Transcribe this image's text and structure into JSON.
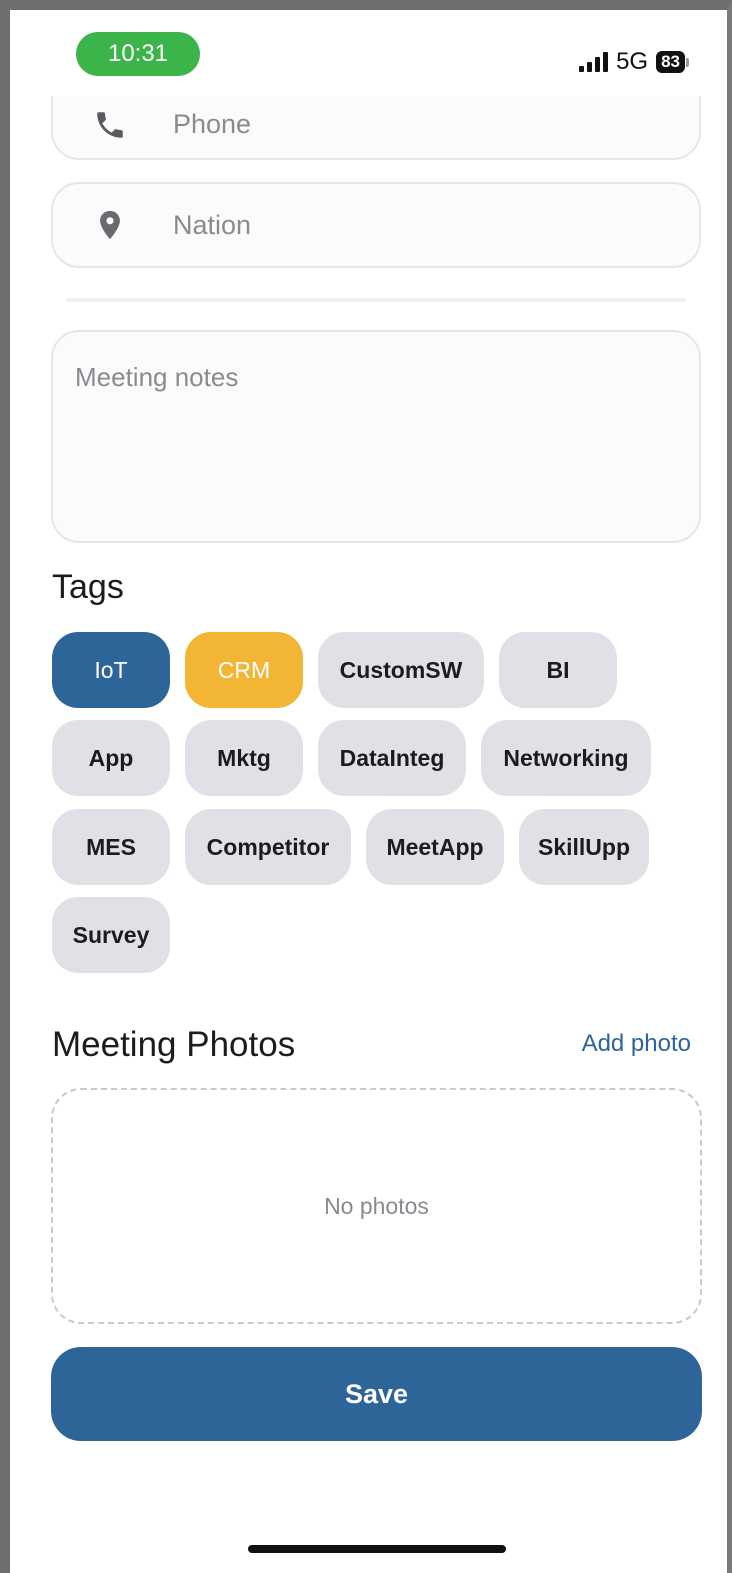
{
  "status_bar": {
    "time": "10:31",
    "network": "5G",
    "battery": "83"
  },
  "form": {
    "phone_placeholder": "Phone",
    "nation_placeholder": "Nation",
    "notes_placeholder": "Meeting notes"
  },
  "tags": {
    "title": "Tags",
    "items": [
      {
        "label": "IoT",
        "state": "selected",
        "color": "#2e6599"
      },
      {
        "label": "CRM",
        "state": "selected",
        "color": "#f2b534"
      },
      {
        "label": "CustomSW",
        "state": "unselected"
      },
      {
        "label": "BI",
        "state": "unselected"
      },
      {
        "label": "App",
        "state": "unselected"
      },
      {
        "label": "Mktg",
        "state": "unselected"
      },
      {
        "label": "DataInteg",
        "state": "unselected"
      },
      {
        "label": "Networking",
        "state": "unselected"
      },
      {
        "label": "MES",
        "state": "unselected"
      },
      {
        "label": "Competitor",
        "state": "unselected"
      },
      {
        "label": "MeetApp",
        "state": "unselected"
      },
      {
        "label": "SkillUpp",
        "state": "unselected"
      },
      {
        "label": "Survey",
        "state": "unselected"
      }
    ]
  },
  "photos": {
    "title": "Meeting Photos",
    "add_label": "Add photo",
    "empty_text": "No photos"
  },
  "save_label": "Save",
  "colors": {
    "accent": "#2e6599",
    "highlight": "#f2b534",
    "time_pill": "#3bb54a"
  }
}
